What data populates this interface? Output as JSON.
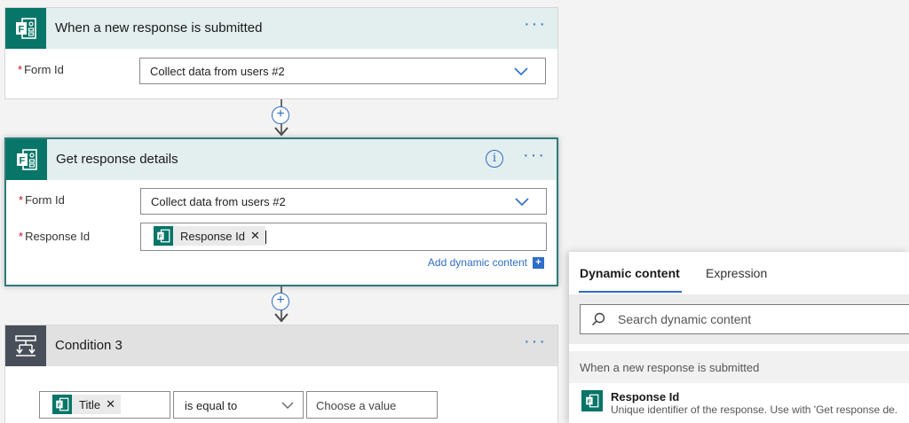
{
  "trigger": {
    "title": "When a new response is submitted",
    "form_id_label": "Form Id",
    "form_id_value": "Collect data from users #2"
  },
  "get_details": {
    "title": "Get response details",
    "form_id_label": "Form Id",
    "form_id_value": "Collect data from users #2",
    "response_id_label": "Response Id",
    "response_token": "Response Id",
    "add_dynamic": "Add dynamic content",
    "add_dynamic_plus": "+"
  },
  "condition": {
    "title": "Condition 3",
    "token": "Title",
    "operator": "is equal to",
    "value_placeholder": "Choose a value"
  },
  "panel": {
    "tab_dynamic": "Dynamic content",
    "tab_expression": "Expression",
    "search_placeholder": "Search dynamic content",
    "section_title": "When a new response is submitted",
    "item_title": "Response Id",
    "item_desc": "Unique identifier of the response. Use with 'Get response de."
  },
  "colors": {
    "forms_green": "#077568",
    "accent_blue": "#2e6dc8",
    "required_red": "#c50f1f"
  },
  "icons": [
    "forms-icon",
    "more-options-icon",
    "chevron-down-icon",
    "info-icon",
    "plus-circle-icon",
    "condition-icon",
    "close-icon",
    "search-icon"
  ]
}
